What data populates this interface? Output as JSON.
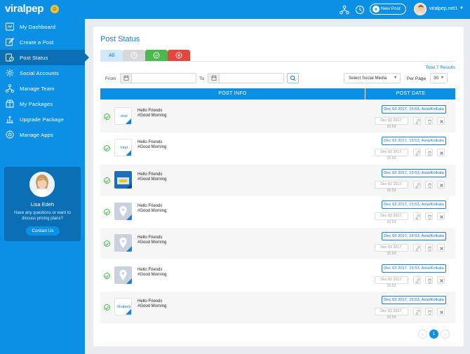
{
  "app": {
    "logo": "viralpep",
    "new_post_label": "New Post",
    "user_name": "viralpep.net1",
    "brand_color": "#0c90e6"
  },
  "sidebar": {
    "items": [
      {
        "label": "My Dashboard",
        "icon": "dashboard-icon"
      },
      {
        "label": "Create a Post",
        "icon": "create-post-icon"
      },
      {
        "label": "Post Status",
        "icon": "post-status-icon",
        "active": true
      },
      {
        "label": "Social Accounts",
        "icon": "social-accounts-icon"
      },
      {
        "label": "Manage Team",
        "icon": "team-icon"
      },
      {
        "label": "My Packages",
        "icon": "packages-icon"
      },
      {
        "label": "Upgrade Package",
        "icon": "upgrade-icon"
      },
      {
        "label": "Manage Apps",
        "icon": "apps-icon"
      }
    ],
    "support": {
      "name": "Lisa Edeh",
      "text": "Have any questions or want to discuss pricing plans?",
      "button": "Contact Us"
    }
  },
  "main": {
    "title": "Post Status",
    "tabs": {
      "all": "All"
    },
    "total_results": "Total 7 Results",
    "filters": {
      "from_label": "From",
      "to_label": "To",
      "social_select": "Select Social Media",
      "per_page_label": "Per Page",
      "per_page_value": "30"
    },
    "table": {
      "headers": [
        "POST INFO",
        "POST DATE"
      ],
      "rows": [
        {
          "thumb": "text",
          "thumb_text": "viral",
          "line1": "Hello Friends",
          "line2": "#Good Morning",
          "date": "Dec 02 2017, 15:53, Asia/Kolkata",
          "edit_date": "Dec 02 2017, 15:53"
        },
        {
          "thumb": "text",
          "thumb_text": "Viral",
          "line1": "Hello Friends",
          "line2": "#Good Morning",
          "date": "Dec 02 2017, 15:53, Asia/Kolkata",
          "edit_date": "Dec 02 2017, 15:53"
        },
        {
          "thumb": "photo",
          "line1": "Hello Friends",
          "line2": "#Good Morning",
          "date": "Dec 02 2017, 15:53, Asia/Kolkata",
          "edit_date": "Dec 02 2017, 15:53"
        },
        {
          "thumb": "location",
          "line1": "Hello Friends",
          "line2": "#Good Morning",
          "date": "Dec 02 2017, 15:53, Asia/Kolkata",
          "edit_date": "Dec 02 2017, 15:53"
        },
        {
          "thumb": "location",
          "line1": "Hello Friends",
          "line2": "#Good Morning",
          "date": "Dec 02 2017, 15:53, Asia/Kolkata",
          "edit_date": "Dec 02 2017, 15:53"
        },
        {
          "thumb": "location",
          "line1": "Hello Friends",
          "line2": "#Good Morning",
          "date": "Dec 02 2017, 15:53, Asia/Kolkata",
          "edit_date": "Dec 02 2017, 15:53"
        },
        {
          "thumb": "text",
          "thumb_text": "Viralpep",
          "line1": "Hello Friends",
          "line2": "#Good Morning",
          "date": "Dec 02 2017, 15:53, Asia/Kolkata",
          "edit_date": "Dec 02 2017, 15:53"
        }
      ]
    },
    "pagination": {
      "prev": "‹",
      "current": "1",
      "next": "›"
    }
  }
}
